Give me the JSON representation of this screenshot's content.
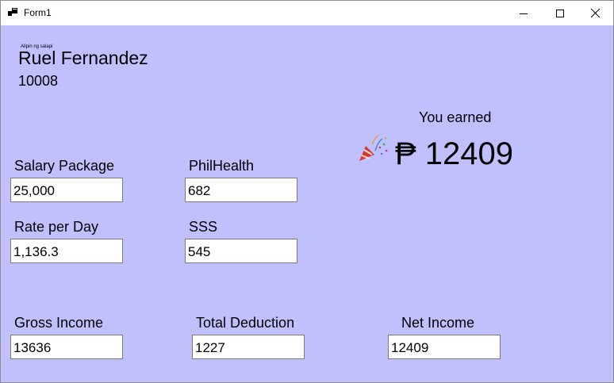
{
  "window": {
    "title": "Form1"
  },
  "header": {
    "tagline": "Alipin ng salapi",
    "employee_name": "Ruel Fernandez",
    "employee_id": "10008"
  },
  "earned": {
    "label": "You earned",
    "amount": "₱ 12409",
    "icon": "party-popper-icon"
  },
  "fields": {
    "salary_package": {
      "label": "Salary Package",
      "value": "25,000"
    },
    "rate_per_day": {
      "label": "Rate per Day",
      "value": "1,136.3"
    },
    "philhealth": {
      "label": "PhilHealth",
      "value": "682"
    },
    "sss": {
      "label": "SSS",
      "value": "545"
    },
    "gross_income": {
      "label": "Gross Income",
      "value": "13636"
    },
    "total_deduction": {
      "label": "Total Deduction",
      "value": "1227"
    },
    "net_income": {
      "label": "Net Income",
      "value": "12409"
    }
  },
  "colors": {
    "client_background": "#c0c0ff",
    "textbox_border": "#7a7a7a"
  }
}
